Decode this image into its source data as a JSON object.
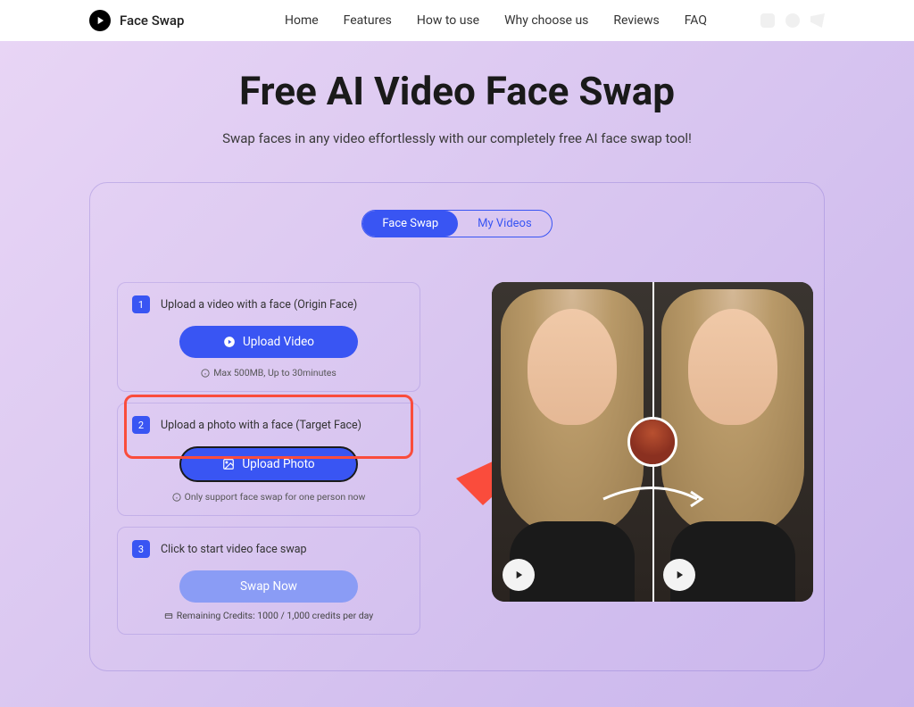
{
  "header": {
    "brand": "Face Swap",
    "nav": [
      "Home",
      "Features",
      "How to use",
      "Why choose us",
      "Reviews",
      "FAQ"
    ]
  },
  "hero": {
    "title": "Free AI Video Face Swap",
    "subtitle": "Swap faces in any video effortlessly with our completely free AI face swap tool!"
  },
  "tabs": {
    "face_swap": "Face Swap",
    "my_videos": "My Videos"
  },
  "steps": {
    "s1": {
      "num": "1",
      "text": "Upload a video with a face  (Origin Face)",
      "btn": "Upload Video",
      "note": "Max 500MB, Up to 30minutes"
    },
    "s2": {
      "num": "2",
      "text": "Upload a photo with a face  (Target Face)",
      "btn": "Upload Photo",
      "note": "Only support face swap for one person now"
    },
    "s3": {
      "num": "3",
      "text": "Click to start video face swap",
      "btn": "Swap Now",
      "credits": "Remaining Credits:  1000 / 1,000 credits per day"
    }
  },
  "colors": {
    "primary": "#3955f3",
    "highlight": "#fa4c3c"
  }
}
